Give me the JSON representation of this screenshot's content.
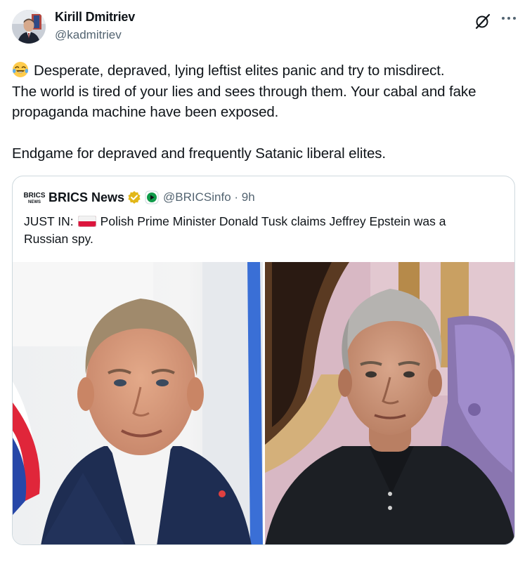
{
  "post": {
    "author_name": "Kirill Dmitriev",
    "author_handle": "@kadmitriev",
    "avatar_alt": "Kirill Dmitriev avatar",
    "text_lines": [
      "Desperate, depraved, lying leftist elites panic and try to misdirect.",
      "The world is tired of your lies and sees through them. Your cabal and fake",
      "propaganda machine have been exposed.",
      "Endgame for depraved and frequently Satanic liberal elites."
    ],
    "emoji": "laughing-crying-face-emoji",
    "icons": {
      "grok": "grok-slash-icon",
      "more": "more-options-icon"
    }
  },
  "quote": {
    "logo_text": "BRICS",
    "logo_subtext": "NEWS",
    "name": "BRICS News",
    "handle_time": "@BRICSinfo · 9h",
    "text_prefix": "JUST IN:",
    "text_line1_rest": "Polish Prime Minister Donald Tusk claims Jeffrey Epstein was a",
    "text_line2": "Russian spy.",
    "flag": "poland-flag",
    "badge": "gold-verified-badge",
    "affiliate": "affiliate-badge-icon",
    "media": [
      {
        "name": "photo-donald-tusk"
      },
      {
        "name": "photo-jeffrey-epstein"
      }
    ]
  },
  "colors": {
    "text": "#0f1419",
    "secondary": "#536471",
    "border": "#cfd9de",
    "gold": "#e2b719",
    "flag_red": "#dc143c"
  }
}
